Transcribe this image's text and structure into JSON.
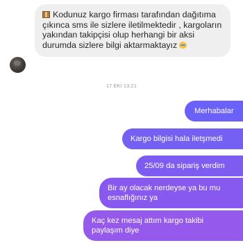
{
  "conversation": {
    "incoming_message": {
      "text": "Kodunuz kargo firması tarafından dağıtıma çıkınca sms ile sizlere iletilmektedir , kargoların yakından takipçisi olup herhangi bir aksi durumda sizlere bilgi aktarmaktayız",
      "leading_icon": "package-icon",
      "trailing_icon": "crying-face-icon"
    },
    "timestamp": "17 EKİ 13:21",
    "outgoing_messages": [
      "Merhabalar",
      "Kargo bilgisi hala iletşmedi",
      "25/09 da sipariş verdim",
      "Bir ay olacak nerdeyse ya bu mu esnaflığınız ya",
      "Kaç kez mesaj attım kargo takibi paylaşım diye"
    ],
    "colors": {
      "incoming_bubble": "#efefef",
      "outgoing_bubble_top": "#6b60f7",
      "outgoing_bubble_bottom": "#955aec",
      "timestamp_text": "#9a9a9a"
    }
  }
}
